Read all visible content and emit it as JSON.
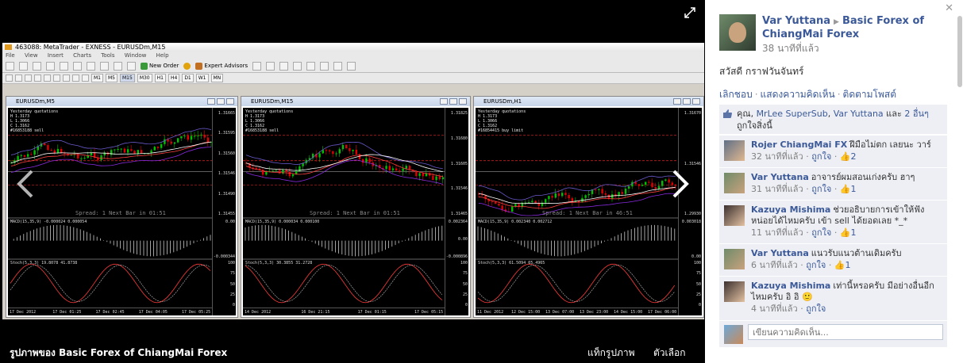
{
  "photo": {
    "caption": "รูปภาพของ Basic Forex of ChiangMai Forex",
    "tag_label": "แท็กรูปภาพ",
    "options_label": "ตัวเลือก",
    "metatrader": {
      "window_title": "463088: MetaTrader - EXNESS - EURUSDm,M15",
      "menu": [
        "File",
        "View",
        "Insert",
        "Charts",
        "Tools",
        "Window",
        "Help"
      ],
      "toolbar": {
        "new_order": "New Order",
        "expert_advisors": "Expert Advisors"
      },
      "timeframes": [
        "M1",
        "M5",
        "M15",
        "M30",
        "H1",
        "H4",
        "D1",
        "W1",
        "MN"
      ],
      "active_timeframe": "M15",
      "charts": [
        {
          "title": "EURUSDm,M5",
          "overlay": "Yesterday quotations\nH 1.3173\nL 1.3066\nC 1.3162\n#16853188 sell",
          "price_labels": [
            "1.31665",
            "1.31595",
            "1.31560",
            "1.31546",
            "1.31490",
            "1.31455"
          ],
          "spread": "Spread: 1    Next Bar in 01:51",
          "macd_label": "MACD(15,35,9) -0.000024 0.000054",
          "macd_axis": [
            "0.00",
            "-0.000344"
          ],
          "stoch_label": "Stoch(5,3,3) 19.8078 41.8738",
          "stoch_axis": [
            "100",
            "75",
            "50",
            "25",
            "0"
          ],
          "dates": [
            "17 Dec 2012",
            "17 Dec 01:25",
            "17 Dec 02:45",
            "17 Dec 04:05",
            "17 Dec 05:25"
          ]
        },
        {
          "title": "EURUSDm,M15",
          "overlay": "Yesterday quotations\nH 1.3173\nL 1.3066\nC 1.3162\n#16853188 sell",
          "price_labels": [
            "1.31825",
            "1.31680",
            "1.31605",
            "1.31546",
            "1.31465"
          ],
          "spread": "Spread: 1    Next Bar in 01:51",
          "macd_label": "MACD(15,35,9) 0.000034 0.000100",
          "macd_axis": [
            "0.002364",
            "0.00",
            "-0.000896"
          ],
          "stoch_label": "Stoch(5,3,3) 30.3855 31.2728",
          "stoch_axis": [
            "100",
            "75",
            "50",
            "25",
            "0"
          ],
          "dates": [
            "14 Dec 2012",
            "16 Dec 21:15",
            "17 Dec 01:15",
            "17 Dec 05:15"
          ]
        },
        {
          "title": "EURUSDm,H1",
          "overlay": "Yesterday quotations\nH 1.3173\nL 1.3066\nC 1.3162\n#16854415 buy limit",
          "price_labels": [
            "1.31670",
            "1.31546",
            "1.29930"
          ],
          "spread": "Spread: 1    Next Bar in 46:51",
          "macd_label": "MACD(15,35,9) 0.002340 0.002712",
          "macd_axis": [
            "0.003018",
            "0.00"
          ],
          "stoch_label": "Stoch(5,3,3) 61.5094 65.4965",
          "stoch_axis": [
            "100",
            "75",
            "50",
            "25",
            "0"
          ],
          "dates": [
            "11 Dec 2012",
            "12 Dec 15:00",
            "13 Dec 07:00",
            "13 Dec 23:00",
            "14 Dec 15:00",
            "17 Dec 06:00"
          ]
        }
      ]
    }
  },
  "post": {
    "author": "Var Yuttana",
    "target": "Basic Forex of ChiangMai Forex",
    "time": "38 นาทีที่แล้ว",
    "text": "สวัสดี กราฟวันจันทร์",
    "actions": [
      "เลิกชอบ",
      "แสดงความคิดเห็น",
      "ติดตามโพสต์"
    ],
    "likes": {
      "prefix": "คุณ,",
      "people": [
        "MrLee SuperSub",
        "Var Yuttana"
      ],
      "and_word": "และ",
      "others": "2 อื่นๆ",
      "suffix": "ถูกใจสิ่งนี้"
    },
    "comments": [
      {
        "name": "Rojer ChiangMai FX",
        "text": "ฝีมือไม่ตก เลยนะ วาร์",
        "time": "32 นาทีที่แล้ว",
        "like_label": "ถูกใจ",
        "like_count": "2"
      },
      {
        "name": "Var Yuttana",
        "text": "อาจารย์ผมสอนเก่งครับ ฮาๆ",
        "time": "31 นาทีที่แล้ว",
        "like_label": "ถูกใจ",
        "like_count": "1"
      },
      {
        "name": "Kazuya Mishima",
        "text": "ช่วยอธิบายการเข้าให้ฟังหน่อยได้ไหมครับ เข้า sell ได้ยอดเลย *_*",
        "time": "11 นาทีที่แล้ว",
        "like_label": "ถูกใจ",
        "like_count": "1"
      },
      {
        "name": "Var Yuttana",
        "text": "แนวรับแนวต้านเดิมครับ",
        "time": "6 นาทีที่แล้ว",
        "like_label": "ถูกใจ",
        "like_count": "1"
      },
      {
        "name": "Kazuya Mishima",
        "text": "เท่านี้หรอครับ มีอย่างอื่นอีกไหมครับ อิ อิ 🙂",
        "time": "4 นาทีที่แล้ว",
        "like_label": "ถูกใจ",
        "like_count": ""
      }
    ],
    "comment_placeholder": "เขียนความคิดเห็น..."
  },
  "colors": {
    "link": "#3b5998",
    "panel_bg": "#edeff4",
    "chart_bg": "#000000",
    "bull_candle": "#00c000",
    "bear_candle": "#e00000"
  }
}
